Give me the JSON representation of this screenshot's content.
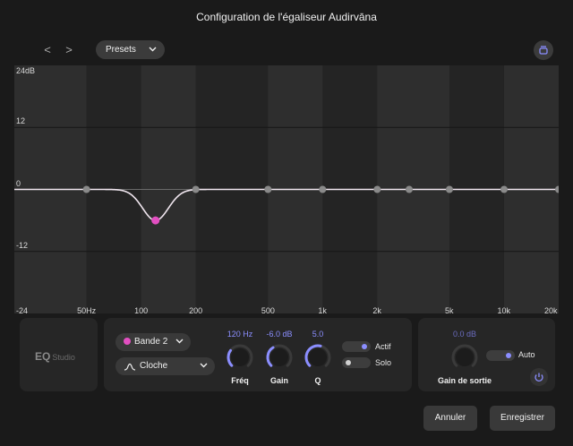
{
  "window": {
    "title": "Configuration de l'égaliseur Audirvāna"
  },
  "toolbar": {
    "back_glyph": "<",
    "forward_glyph": ">",
    "presets_label": "Presets",
    "eq_icon": "stack-icon"
  },
  "graph": {
    "y_labels": [
      "24dB",
      "12",
      "0",
      "-12"
    ],
    "x_labels": [
      "-24",
      "50Hz",
      "100",
      "200",
      "500",
      "1k",
      "2k",
      "5k",
      "10k",
      "20k"
    ],
    "selected_point_color": "#e24fc1",
    "curve_color": "#f0e6ef",
    "band_nodes": [
      {
        "freq": 50,
        "gain": 0
      },
      {
        "freq": 120,
        "gain": -6
      },
      {
        "freq": 200,
        "gain": 0
      },
      {
        "freq": 500,
        "gain": 0
      },
      {
        "freq": 1000,
        "gain": 0
      },
      {
        "freq": 2000,
        "gain": 0
      },
      {
        "freq": 3000,
        "gain": 0
      },
      {
        "freq": 5000,
        "gain": 0
      },
      {
        "freq": 10000,
        "gain": 0
      },
      {
        "freq": 20000,
        "gain": 0
      }
    ]
  },
  "logo": {
    "eq": "EQ",
    "studio": "Studio"
  },
  "band": {
    "band_select": "Bande 2",
    "type_select": "Cloche",
    "type_icon": "bell-curve-icon",
    "freq": {
      "value": "120 Hz",
      "label": "Fréq",
      "level": 0.3
    },
    "gain": {
      "value": "-6.0 dB",
      "label": "Gain",
      "level": 0.38
    },
    "q": {
      "value": "5.0",
      "label": "Q",
      "level": 0.55
    },
    "actif": {
      "label": "Actif",
      "on": true
    },
    "solo": {
      "label": "Solo",
      "on": false
    }
  },
  "output": {
    "value": "0.0 dB",
    "label": "Gain de sortie",
    "auto": {
      "label": "Auto",
      "on": true
    }
  },
  "buttons": {
    "cancel": "Annuler",
    "save": "Enregistrer"
  },
  "colors": {
    "accent": "#8b8eff",
    "band": "#e24fc1"
  }
}
